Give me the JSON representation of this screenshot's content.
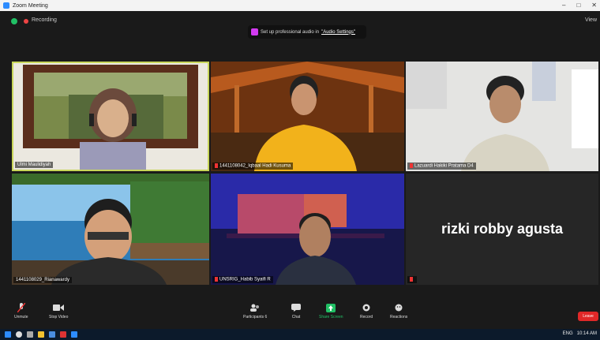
{
  "window": {
    "title": "Zoom Meeting"
  },
  "topbar": {
    "recording_label": "Recording",
    "notification_text": "Set up professional audio in",
    "notification_link": "\"Audio Settings\"",
    "view_label": "View"
  },
  "participants": [
    {
      "name": "Ulmi Maulidiyah"
    },
    {
      "name": "1441108042_Iqbaal Hadi Kusuma"
    },
    {
      "name": "Lazuardi Hakiki Pratama D4"
    },
    {
      "name": "1441108029_Rianawardy"
    },
    {
      "name": "UNSRIG_Habib Syaifi R"
    },
    {
      "name": "rizki robby agusta"
    }
  ],
  "toolbar": {
    "unmute": "Unmute",
    "stop_video": "Stop Video",
    "participants": "Participants",
    "participants_count": "6",
    "chat": "Chat",
    "share_screen": "Share Screen",
    "record": "Record",
    "reactions": "Reactions",
    "leave": "Leave"
  },
  "taskbar": {
    "lang": "ENG",
    "time": "10:14 AM"
  },
  "colors": {
    "share_green": "#21c065",
    "leave_red": "#e02828",
    "active_speaker": "#c8d65a"
  }
}
